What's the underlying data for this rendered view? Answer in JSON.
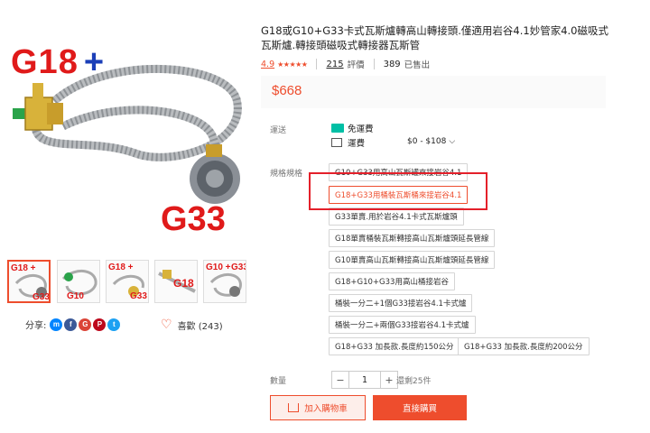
{
  "product": {
    "title": "G18或G10+G33卡式瓦斯爐轉高山轉接頭.僅適用岩谷4.1妙管家4.0磁吸式瓦斯爐.轉接頭磁吸式轉接器瓦斯管",
    "image_label_top": "G18",
    "image_label_plus": "+",
    "image_label_bottom": "G33",
    "thumbnails": [
      {
        "label": "G18 +",
        "sub": "G33"
      },
      {
        "label": "",
        "sub": "G10"
      },
      {
        "label": "G18 +",
        "sub": "G33"
      },
      {
        "label": "G18",
        "sub": ""
      },
      {
        "label": "G10 +",
        "sub": "G33"
      }
    ]
  },
  "stats": {
    "rating": "4.9",
    "stars": "★★★★★",
    "reviews_count": "215",
    "reviews_label": "評價",
    "sold_count": "389",
    "sold_label": "已售出"
  },
  "price": "$668",
  "shipping": {
    "label": "運送",
    "free_label": "免運費",
    "fee_label": "運費",
    "fee_range": "$0 - $108"
  },
  "spec": {
    "label": "規格規格",
    "options": [
      "G10+G33用高山瓦斯罐來接岩谷4.1",
      "G18+G33用桶裝瓦斯桶來接岩谷4.1",
      "G33單賣.用於岩谷4.1卡式瓦斯爐頭",
      "G18單賣桶裝瓦斯轉接高山瓦斯爐頭延長管線",
      "G10單賣高山瓦斯轉接高山瓦斯爐頭延長管線",
      "G18+G10+G33用高山桶接岩谷",
      "桶裝一分二+1個G33接岩谷4.1卡式爐",
      "桶裝一分二+兩個G33接岩谷4.1卡式爐",
      "G18+G33 加長款.長度約150公分",
      "G18+G33 加長款.長度約200公分"
    ],
    "selected_index": 1
  },
  "share": {
    "label": "分享:"
  },
  "favorite": {
    "label": "喜歡 (243)"
  },
  "quantity": {
    "label": "數量",
    "minus": "−",
    "value": "1",
    "plus": "+",
    "stock": "還剩25件"
  },
  "buttons": {
    "add_to_cart": "加入購物車",
    "buy_now": "直接購買"
  },
  "colors": {
    "accent": "#ee4d2d",
    "highlight_box": "#e4202a",
    "free_ship": "#00bfa5"
  }
}
